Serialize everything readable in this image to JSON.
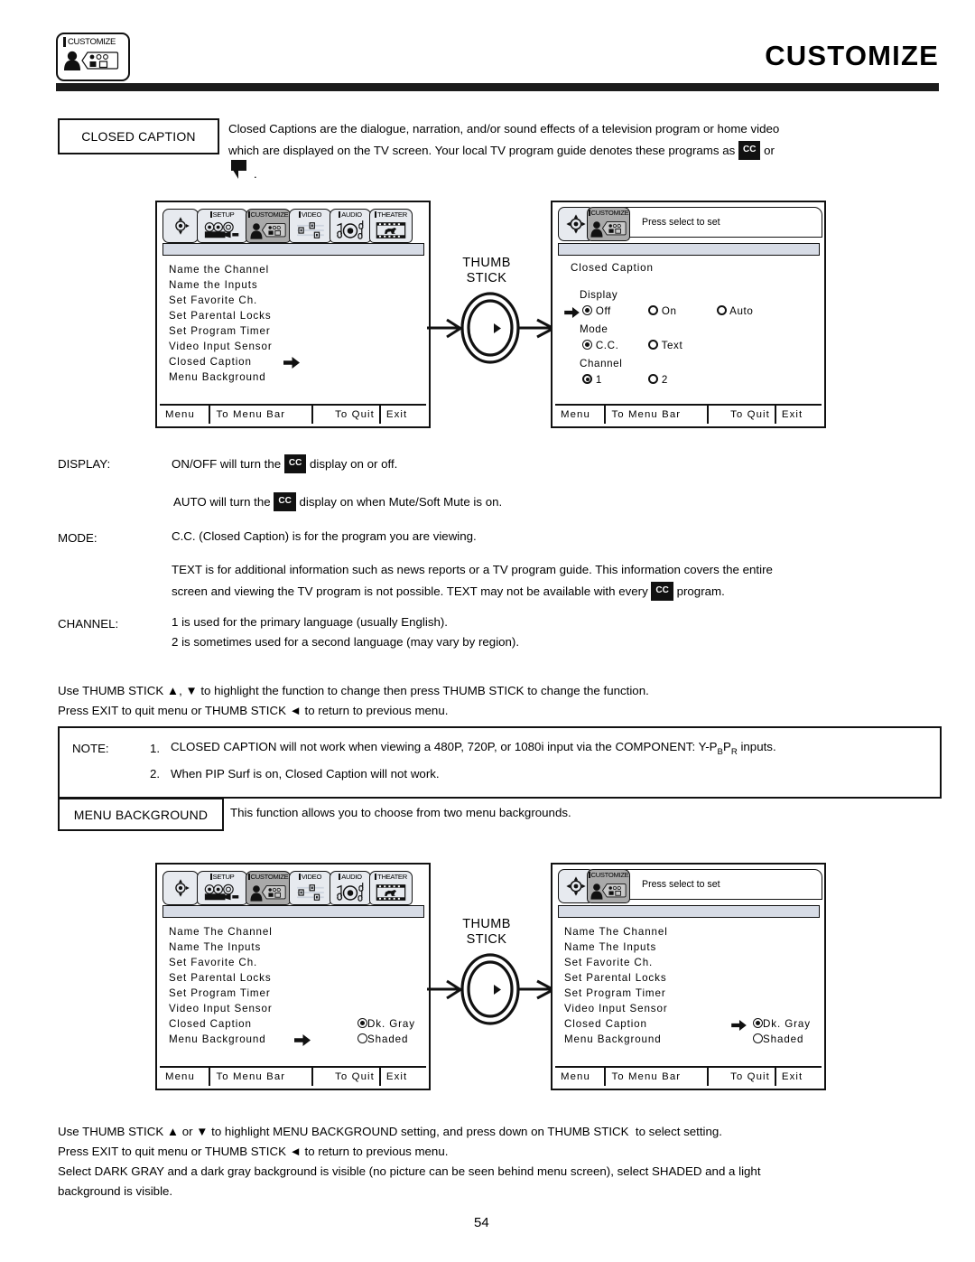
{
  "header": {
    "icon_label": "CUSTOMIZE",
    "title": "CUSTOMIZE"
  },
  "closed_caption_section": {
    "box_label": "CLOSED CAPTION",
    "desc_line1": "Closed Captions are the dialogue, narration, and/or sound effects of a television program or home video",
    "desc_line2_a": "which are displayed on the TV screen.  Your local TV program guide denotes these programs as",
    "cc_badge": "CC",
    "desc_line2_b": "or",
    "desc_line3": "."
  },
  "screen1": {
    "menu_bar_tabs": [
      {
        "label": "",
        "icon": "thumbstick-icon",
        "selected": false
      },
      {
        "label": "SETUP",
        "icon": "camcorder-icon",
        "selected": false
      },
      {
        "label": "CUSTOMIZE",
        "icon": "person-remote-icon",
        "selected": true
      },
      {
        "label": "VIDEO",
        "icon": "sliders-icon",
        "selected": false
      },
      {
        "label": "AUDIO",
        "icon": "speaker-notes-icon",
        "selected": false
      },
      {
        "label": "THEATER",
        "icon": "film-horse-icon",
        "selected": false
      }
    ],
    "items": [
      "Name the Channel",
      "Name the Inputs",
      "Set Favorite Ch.",
      "Set Parental Locks",
      "Set Program Timer",
      "Video Input Sensor",
      "Closed Caption",
      "Menu Background"
    ],
    "cursor_item_index": 6,
    "bottom_bar": [
      "Menu",
      "To Menu Bar",
      "To Quit",
      "Exit"
    ]
  },
  "screen2": {
    "tab_label": "CUSTOMIZE",
    "tab_hint": "Press select to set",
    "title": "Closed Caption",
    "groups": [
      {
        "label": "Display",
        "cursor": true,
        "options": [
          {
            "label": "Off",
            "selected": true
          },
          {
            "label": "On",
            "selected": false
          },
          {
            "label": "Auto",
            "selected": false
          }
        ]
      },
      {
        "label": "Mode",
        "cursor": false,
        "options": [
          {
            "label": "C.C.",
            "selected": true
          },
          {
            "label": "Text",
            "selected": false
          }
        ]
      },
      {
        "label": "Channel",
        "cursor": false,
        "options": [
          {
            "label": "1",
            "selected": true
          },
          {
            "label": "2",
            "selected": false
          }
        ]
      }
    ],
    "bottom_bar": [
      "Menu",
      "To Menu Bar",
      "To Quit",
      "Exit"
    ]
  },
  "thumb_stick_1": {
    "line1": "THUMB",
    "line2": "STICK"
  },
  "thumb_stick_2": {
    "line1": "THUMB",
    "line2": "STICK"
  },
  "definitions": [
    {
      "term": "DISPLAY:",
      "lines": [
        {
          "pre": "ON/OFF  will turn the",
          "badge": "CC",
          "post": "display on or off."
        },
        {
          "pre": "AUTO will turn the",
          "badge": "CC",
          "post": "display on when Mute/Soft Mute is on.",
          "indent": true
        }
      ]
    },
    {
      "term": "MODE:",
      "lines": [
        {
          "pre": "C.C. (Closed Caption) is for the program you are viewing."
        },
        {
          "pre": "TEXT is for additional information such as news reports or a TV program guide.  This information covers the entire"
        },
        {
          "pre": "screen and viewing the TV program is not possible.  TEXT may not be available with every",
          "badge": "CC",
          "post": "program."
        }
      ]
    },
    {
      "term": "CHANNEL:",
      "lines": [
        {
          "pre": "1  is used for the primary language (usually English)."
        },
        {
          "pre": "2 is sometimes used for a second language (may vary by region)."
        }
      ]
    }
  ],
  "usage_1": {
    "line1": "Use THUMB STICK ▲, ▼ to highlight the function to change then press THUMB STICK to change the function.",
    "line2": "Press EXIT to quit menu or THUMB STICK ◄ to return to previous menu."
  },
  "note": {
    "label": "NOTE:",
    "items": [
      {
        "num": "1.",
        "text_a": "CLOSED CAPTION will not work when viewing a 480P, 720P, or 1080i input via the COMPONENT: Y-P",
        "sub_b": "B",
        "text_b": "P",
        "sub_r": "R",
        "text_c": " inputs."
      },
      {
        "num": "2.",
        "text_a": "When PIP Surf is on, Closed Caption will not work."
      }
    ]
  },
  "menu_background_section": {
    "box_label": "MENU BACKGROUND",
    "desc": "This function allows you to choose from two menu backgrounds."
  },
  "screen3": {
    "menu_bar_tabs": [
      {
        "label": "",
        "icon": "thumbstick-icon",
        "selected": false
      },
      {
        "label": "SETUP",
        "icon": "camcorder-icon",
        "selected": false
      },
      {
        "label": "CUSTOMIZE",
        "icon": "person-remote-icon",
        "selected": true
      },
      {
        "label": "VIDEO",
        "icon": "sliders-icon",
        "selected": false
      },
      {
        "label": "AUDIO",
        "icon": "speaker-notes-icon",
        "selected": false
      },
      {
        "label": "THEATER",
        "icon": "film-horse-icon",
        "selected": false
      }
    ],
    "items": [
      "Name The Channel",
      "Name The Inputs",
      "Set Favorite Ch.",
      "Set Parental Locks",
      "Set Program Timer",
      "Video Input Sensor",
      "Closed Caption",
      "Menu Background"
    ],
    "cursor_item_index": 7,
    "options": [
      {
        "label": "Dk. Gray",
        "selected": true
      },
      {
        "label": "Shaded",
        "selected": false
      }
    ],
    "option_cursor": false,
    "bottom_bar": [
      "Menu",
      "To Menu Bar",
      "To Quit",
      "Exit"
    ]
  },
  "screen4": {
    "tab_label": "CUSTOMIZE",
    "tab_hint": "Press select to set",
    "items": [
      "Name The Channel",
      "Name The Inputs",
      "Set Favorite Ch.",
      "Set Parental Locks",
      "Set Program Timer",
      "Video Input Sensor",
      "Closed Caption",
      "Menu Background"
    ],
    "options": [
      {
        "label": "Dk. Gray",
        "selected": true
      },
      {
        "label": "Shaded",
        "selected": false
      }
    ],
    "option_cursor": true,
    "bottom_bar": [
      "Menu",
      "To Menu Bar",
      "To Quit",
      "Exit"
    ]
  },
  "usage_2": {
    "line1": "Use THUMB STICK ▲ or ▼ to highlight MENU BACKGROUND setting, and press down on THUMB STICK  to select setting.",
    "line2": "Press EXIT to quit menu or THUMB STICK ◄ to return to previous menu.",
    "line3": "Select DARK GRAY and a dark gray background is visible (no picture can be seen behind menu screen), select SHADED and a light",
    "line4": "background is visible."
  },
  "page_number": "54"
}
